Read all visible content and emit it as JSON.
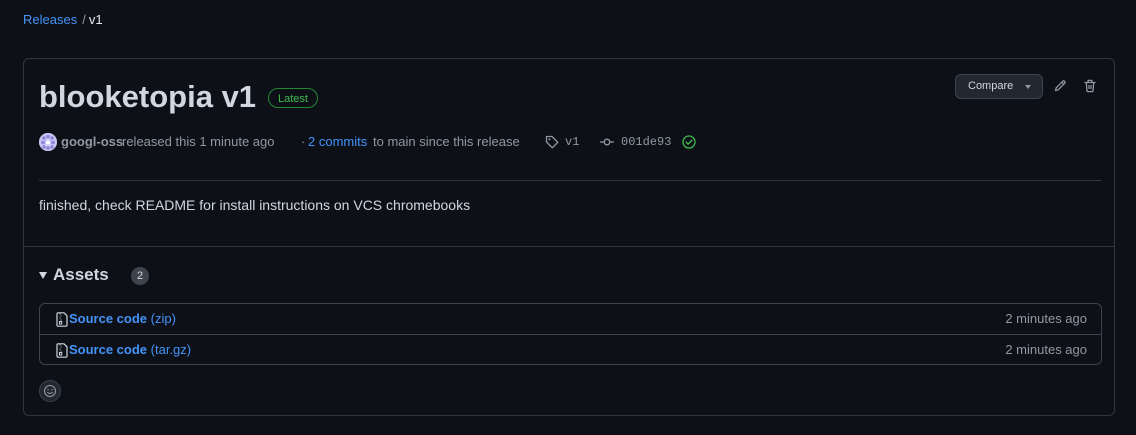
{
  "breadcrumb": {
    "releases_label": "Releases",
    "separator": "/",
    "current": "v1"
  },
  "release": {
    "title": "blooketopia v1",
    "badge": "Latest",
    "compare_label": "Compare",
    "edit_icon": "pencil-icon",
    "delete_icon": "trash-icon",
    "author": "googl-oss",
    "released_text": "released this 1 minute ago",
    "commits_prefix": "·",
    "commits_link": "2 commits",
    "commits_suffix": "to main since this release",
    "tag_icon": "tag-icon",
    "tag": "v1",
    "commit_icon": "git-commit-icon",
    "commit_sha": "001de93",
    "verified_icon": "check-circle-icon",
    "body": "finished, check README for install instructions on VCS chromebooks"
  },
  "assets": {
    "title": "Assets",
    "count": "2",
    "items": [
      {
        "name": "Source code",
        "ext": "(zip)",
        "time": "2 minutes ago",
        "icon": "file-zip-icon"
      },
      {
        "name": "Source code",
        "ext": "(tar.gz)",
        "time": "2 minutes ago",
        "icon": "file-zip-icon"
      }
    ]
  },
  "reaction": {
    "icon": "smiley-icon"
  },
  "colors": {
    "background": "#0d1117",
    "link": "#4493f8",
    "border": "#30363d",
    "success": "#3fb950",
    "muted": "#9198a1"
  }
}
